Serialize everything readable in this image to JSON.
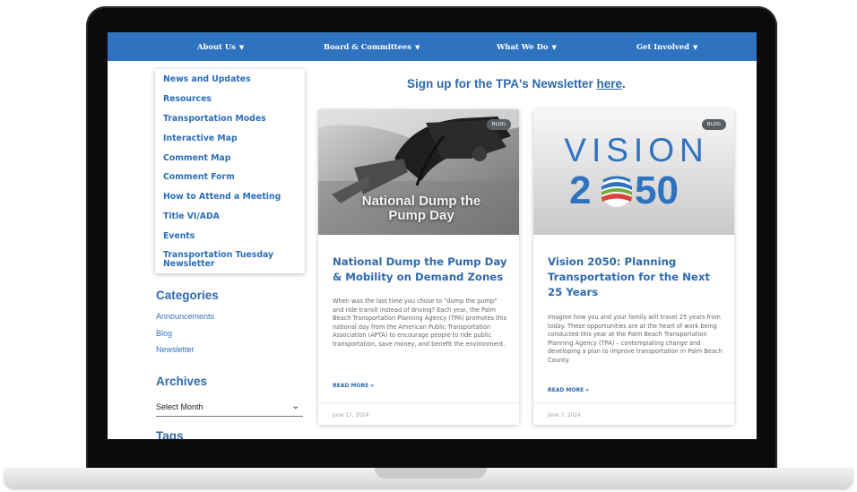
{
  "nav": [
    {
      "label": "About Us"
    },
    {
      "label": "Board & Committees"
    },
    {
      "label": "What We Do"
    },
    {
      "label": "Get Involved"
    }
  ],
  "sidebar_menu": [
    "News and Updates",
    "Resources",
    "Transportation Modes",
    "Interactive Map",
    "Comment Map",
    "Comment Form",
    "How to Attend a Meeting",
    "Title VI/ADA",
    "Events",
    "Transportation Tuesday Newsletter"
  ],
  "categories": {
    "heading": "Categories",
    "items": [
      "Announcements",
      "Blog",
      "Newsletter"
    ]
  },
  "archives": {
    "heading": "Archives",
    "selected": "Select Month"
  },
  "tags_heading": "Tags",
  "newsletter": {
    "prefix": "Sign up for the TPA's Newsletter ",
    "link": "here",
    "suffix": "."
  },
  "posts": [
    {
      "badge": "BLOG",
      "image_text": "National Dump the Pump Day",
      "title": "National Dump the Pump Day & Mobility on Demand Zones",
      "excerpt": "When was the last time you chose to \"dump the pump\" and ride transit instead of driving? Each year, the Palm Beach Transportation Planning Agency (TPA) promotes this national day from the American Public Transportation Association (APTA) to encourage people to ride public transportation, save money, and benefit the environment.",
      "read_more": "READ MORE »",
      "date": "June 17, 2024"
    },
    {
      "badge": "BLOG",
      "image_text_top": "VISION",
      "image_text_left": "2",
      "image_text_right": "50",
      "title": "Vision 2050: Planning Transportation for the Next 25 Years",
      "excerpt": "Imagine how you and your family will travel 25 years from today. These opportunities are at the heart of work being conducted this year at the Palm Beach Transportation Planning Agency (TPA) – contemplating change and developing a plan to improve transportation in Palm Beach County.",
      "read_more": "READ MORE »",
      "date": "June 7, 2024"
    }
  ]
}
